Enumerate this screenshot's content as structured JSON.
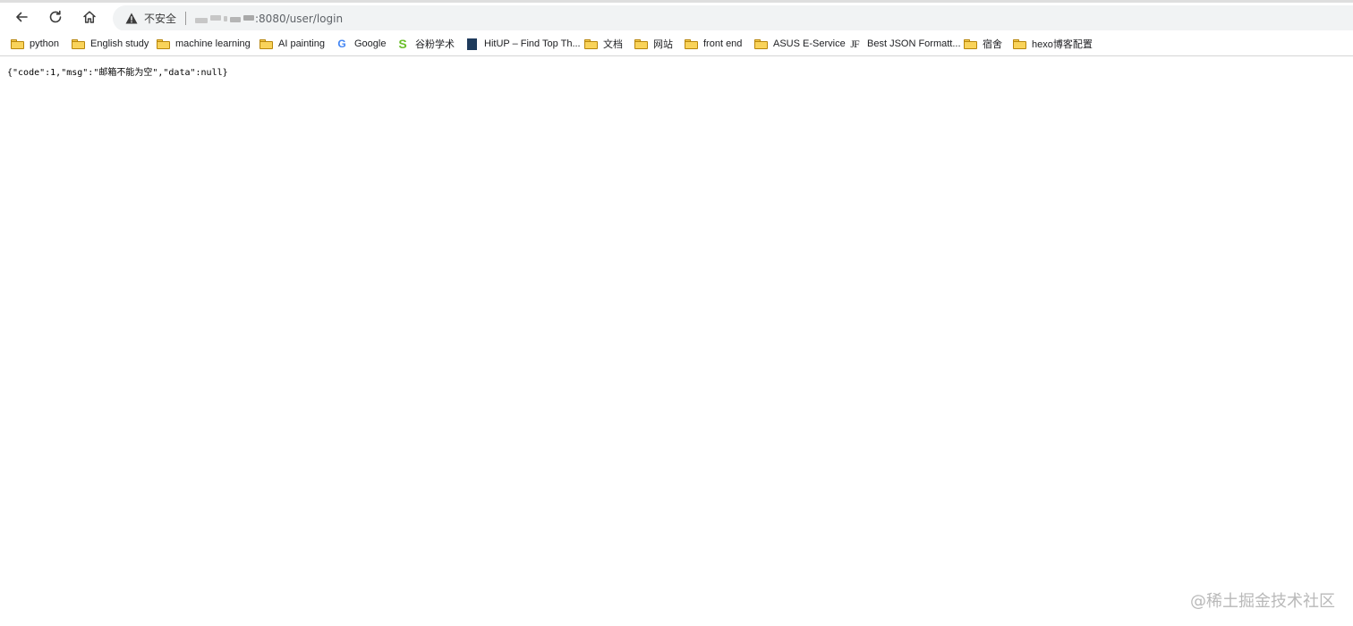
{
  "browser": {
    "security_label": "不安全",
    "url": ":8080/user/login",
    "icons": [
      "back-arrow-icon",
      "reload-icon",
      "home-icon",
      "warning-triangle-icon"
    ]
  },
  "bookmarks": [
    {
      "label": "python",
      "icon": "folder-icon"
    },
    {
      "label": "English study",
      "icon": "folder-icon"
    },
    {
      "label": "machine learning",
      "icon": "folder-icon"
    },
    {
      "label": "AI painting",
      "icon": "folder-icon"
    },
    {
      "label": "Google",
      "icon": "google-icon"
    },
    {
      "label": "谷粉学术",
      "icon": "s-logo-icon"
    },
    {
      "label": "HitUP – Find Top Th...",
      "icon": "hitup-icon"
    },
    {
      "label": "文档",
      "icon": "folder-icon"
    },
    {
      "label": "网站",
      "icon": "folder-icon"
    },
    {
      "label": "front end",
      "icon": "folder-icon"
    },
    {
      "label": "ASUS E-Service",
      "icon": "folder-icon"
    },
    {
      "label": "Best JSON Formatt...",
      "icon": "jf-icon"
    },
    {
      "label": "宿舍",
      "icon": "folder-icon"
    },
    {
      "label": "hexo博客配置",
      "icon": "folder-icon"
    }
  ],
  "page": {
    "body_text": "{\"code\":1,\"msg\":\"邮箱不能为空\",\"data\":null}"
  },
  "watermark": "@稀土掘金技术社区",
  "colors": {
    "folder": "#f9d35a",
    "google_blue": "#4285f4",
    "s_logo_green": "#6bbf2a",
    "hitup_navy": "#1f3b5c",
    "address_bar_bg": "#f1f3f4"
  }
}
